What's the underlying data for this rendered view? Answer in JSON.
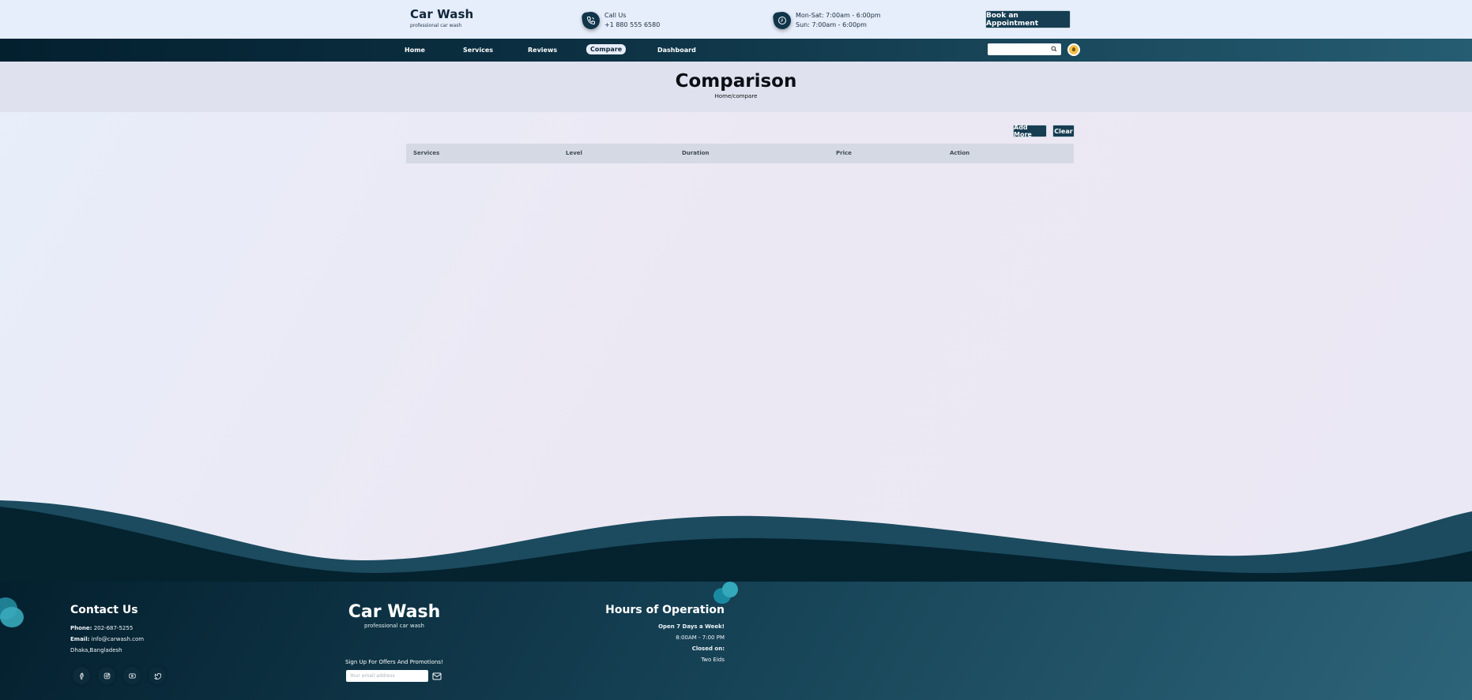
{
  "header": {
    "brand_title": "Car Wash",
    "brand_subtitle": "professional car wash",
    "call_label": "Call Us",
    "call_number": "+1 880 555 6580",
    "hours_weekday": "Mon-Sat: 7:00am - 6:00pm",
    "hours_sunday": "Sun: 7:00am - 6:00pm",
    "book_button": "Book an Appointment"
  },
  "nav": {
    "items": [
      {
        "label": "Home"
      },
      {
        "label": "Services"
      },
      {
        "label": "Reviews"
      },
      {
        "label": "Compare"
      },
      {
        "label": "Dashboard"
      }
    ],
    "active": "Compare"
  },
  "banner": {
    "title": "Comparison",
    "breadcrumb": "Home/compare"
  },
  "actions": {
    "add_more": "Add More",
    "clear": "Clear"
  },
  "table": {
    "columns": [
      "Services",
      "Level",
      "Duration",
      "Price",
      "Action"
    ],
    "rows": []
  },
  "footer": {
    "contact_title": "Contact Us",
    "phone_label": "Phone:",
    "phone_value": "202-687-5255",
    "email_label": "Email:",
    "email_value": "info@carwash.com",
    "address": "Dhaka,Bangladesh",
    "brand_title": "Car Wash",
    "brand_subtitle": "professional car wash",
    "signup_text": "Sign Up For Offers And Promotions!",
    "email_placeholder": "Your email address",
    "hours_title": "Hours of Operation",
    "open_text": "Open 7 Days a Week!",
    "open_hours": "8:00AM - 7:00 PM",
    "closed_label": "Closed on:",
    "closed_value": "Two Eids",
    "social_icons": [
      "facebook-icon",
      "instagram-icon",
      "youtube-icon",
      "twitter-icon"
    ]
  },
  "colors": {
    "primary": "#163d52",
    "dark": "#03202f",
    "accent_toggle": "#f3c14a"
  }
}
